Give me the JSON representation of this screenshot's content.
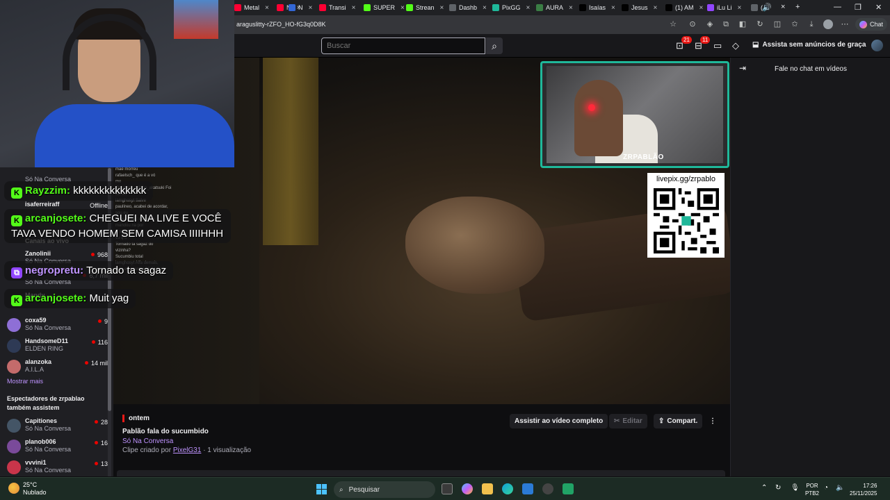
{
  "browser": {
    "tabs": [
      {
        "label": "Metal",
        "color": "#ff0033"
      },
      {
        "label": "N",
        "color": "#ff0033"
      },
      {
        "label": "N",
        "color": "#3367d6"
      },
      {
        "label": "Transi",
        "color": "#ff0033"
      },
      {
        "label": "SUPER",
        "color": "#53fc18"
      },
      {
        "label": "Strean",
        "color": "#53fc18"
      },
      {
        "label": "Dashb",
        "color": "#5f6368"
      },
      {
        "label": "PixGG",
        "color": "#1fb89a"
      },
      {
        "label": "AURA",
        "color": "#3a7d44"
      },
      {
        "label": "Isaías",
        "color": "#010101"
      },
      {
        "label": "Jesus",
        "color": "#010101"
      },
      {
        "label": "(1) AM",
        "color": "#010101"
      },
      {
        "label": "iLu Li",
        "color": "#9146ff"
      },
      {
        "label": "(",
        "color": "#5f6368"
      }
    ],
    "url": "araguslitty-rZFO_HO-fG3q0D8K",
    "chat_button": "Chat"
  },
  "header": {
    "search_placeholder": "Buscar",
    "inbox_badge": "21",
    "notifications_badge": "11",
    "ad_free_label": "Assista sem anúncios de graça"
  },
  "chat_overlay": [
    {
      "platform": "kick",
      "user": "Rayzzim:",
      "text": "kkkkkkkkkkkkkk"
    },
    {
      "platform": "kick",
      "user": "arcanjosete:",
      "text": "CHEGUEI NA LIVE E VOCÊ TAVA VENDO HOMEM SEM CAMISA IIIIHHH"
    },
    {
      "platform": "twitch",
      "user": "negropretu:",
      "text": "Tornado ta sagaz"
    },
    {
      "platform": "kick",
      "user": "arcanjosete:",
      "text": "Muit yag"
    }
  ],
  "sidebar": {
    "partial_rows": [
      {
        "name": "",
        "game": "Só Na Conversa"
      },
      {
        "name": "isaferreiraff",
        "game": "",
        "viewers": "Offline"
      },
      {
        "name": "Canais ao vivo",
        "game": ""
      },
      {
        "name": "Zanolinii",
        "game": "Só Na Conversa",
        "viewers": "968"
      },
      {
        "name": "",
        "game": "Só Na Conversa",
        "viewers": "6,7 mil"
      },
      {
        "name": "Mandy",
        "game": "",
        "viewers": ""
      }
    ],
    "channels": [
      {
        "name": "coxa59",
        "game": "Só Na Conversa",
        "viewers": "9",
        "color": "#8e6fd6"
      },
      {
        "name": "HandsomeD11",
        "game": "ELDEN RING",
        "viewers": "116",
        "color": "#2e3a55"
      },
      {
        "name": "alanzoka",
        "game": "A.I.L.A",
        "viewers": "14 mil",
        "color": "#c46b6b"
      }
    ],
    "show_more": "Mostrar mais",
    "viewers_heading": "Espectadores de zrpablao também assistem",
    "also_watch": [
      {
        "name": "Capitiones",
        "game": "Só Na Conversa",
        "viewers": "28",
        "color": "#445566"
      },
      {
        "name": "planob006",
        "game": "Só Na Conversa",
        "viewers": "16",
        "color": "#7a4a9a"
      },
      {
        "name": "vvvini1",
        "game": "Só Na Conversa",
        "viewers": "13",
        "color": "#c9354a"
      }
    ]
  },
  "stream": {
    "cam_name": "ZRPABLÃO",
    "qr_label": "livepix.gg/zrpablo",
    "ghost_chat": [
      "mãe morreu",
      "rafaelsch_ que é a vó",
      "me",
      "@gabriel_zdinho_akatsuki Foi",
      "aonde",
      "iamghosyt Salve",
      "paulíneo, acabei de acordar,",
      "sou eu",
      "bebuzi, fala: que isso",
      "mandou na por",
      "E só uma",
      "vu q o",
      "Tornado ta sagaz do",
      "vizinha?",
      "Sucumbiu total",
      "iamghosyt Alfa demais,",
      "hoje eu acordei 16 da tarde"
    ]
  },
  "clip": {
    "when": "ontem",
    "title": "Pablão fala do sucumbido",
    "category": "Só Na Conversa",
    "created_by_prefix": "Clipe criado por",
    "creator": "PixelG31",
    "views": "· 1 visualização",
    "watch_full": "Assistir ao vídeo completo",
    "edit": "Editar",
    "share": "Compart."
  },
  "right_panel": {
    "title": "Fale no chat em vídeos"
  },
  "taskbar": {
    "temp": "25°C",
    "weather": "Nublado",
    "search": "Pesquisar",
    "lang1": "POR",
    "lang2": "PTB2",
    "time": "17:26",
    "date": "25/11/2025"
  }
}
